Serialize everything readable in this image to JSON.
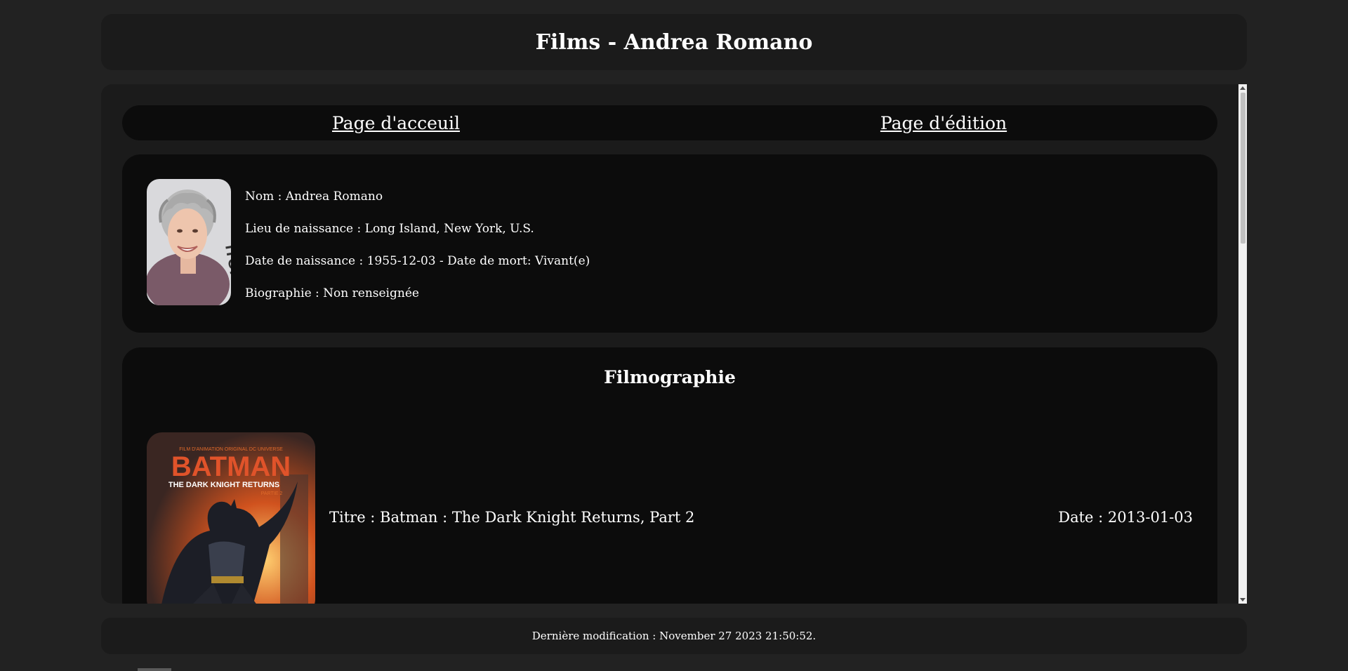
{
  "header": {
    "title": "Films - Andrea Romano"
  },
  "nav": {
    "home_label": "Page d'acceuil",
    "edit_label": "Page d'édition"
  },
  "profile": {
    "name_line": "Nom : Andrea Romano",
    "birthplace_line": "Lieu de naissance : Long Island, New York, U.S.",
    "dates_line": "Date de naissance : 1955-12-03 - Date de mort: Vivant(e)",
    "bio_line": "Biographie : Non renseignée"
  },
  "filmography": {
    "heading": "Filmographie",
    "films": [
      {
        "title_line": "Titre : Batman : The Dark Knight Returns, Part 2",
        "date_line": "Date : 2013-01-03",
        "poster_top_text": "FILM D'ANIMATION ORIGINAL DC UNIVERSE",
        "poster_logo": "BATMAN",
        "poster_subtitle": "THE DARK KNIGHT RETURNS",
        "poster_part": "PARTIE 2"
      }
    ]
  },
  "footer": {
    "last_modified": "Dernière modification : November 27 2023 21:50:52."
  },
  "colors": {
    "page_bg": "#222222",
    "panel_bg": "#1b1b1b",
    "card_bg": "#0c0c0c",
    "text": "#ffffff"
  }
}
